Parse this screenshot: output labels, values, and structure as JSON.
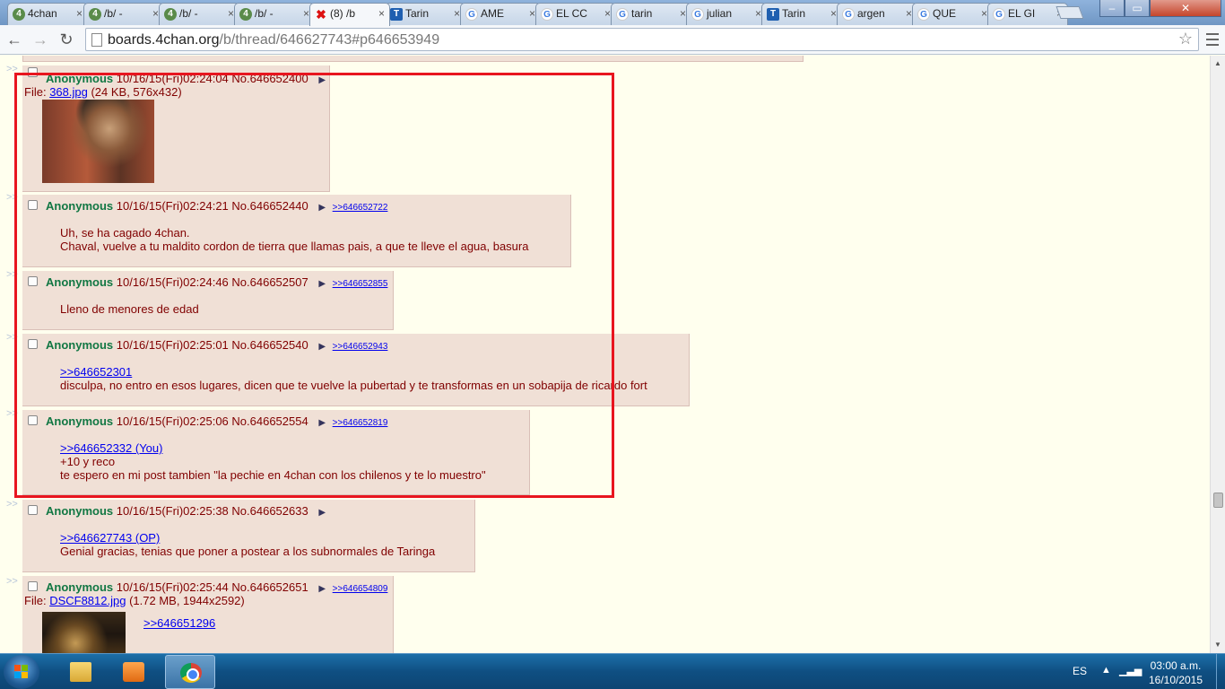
{
  "browser": {
    "tabs": [
      {
        "label": "4chan",
        "icon": "fourchan-icon"
      },
      {
        "label": "/b/ -",
        "icon": "fourchan-icon"
      },
      {
        "label": "/b/ -",
        "icon": "fourchan-icon"
      },
      {
        "label": "/b/ -",
        "icon": "fourchan-icon"
      },
      {
        "label": "(8) /b",
        "icon": "fourchan-clover-icon",
        "active": true
      },
      {
        "label": "Tarin",
        "icon": "taringa-icon"
      },
      {
        "label": "AME",
        "icon": "google-icon"
      },
      {
        "label": "EL CC",
        "icon": "google-icon"
      },
      {
        "label": "tarin",
        "icon": "google-icon"
      },
      {
        "label": "julian",
        "icon": "google-icon"
      },
      {
        "label": "Tarin",
        "icon": "taringa-icon"
      },
      {
        "label": "argen",
        "icon": "google-icon"
      },
      {
        "label": "QUE",
        "icon": "google-icon"
      },
      {
        "label": "EL GI",
        "icon": "google-icon"
      }
    ],
    "tab_close": "×",
    "url_host": "boards.4chan.org",
    "url_path": "/b/thread/646627743#p646653949",
    "back": "←",
    "forward": "→",
    "reload": "↻",
    "star": "☆",
    "win_min": "–",
    "win_max": "▭",
    "win_close": "✕"
  },
  "thread": {
    "side_arrows": ">>",
    "posts": [
      {
        "name": "Anonymous",
        "datetime": "10/16/15(Fri)02:24:04",
        "no": "No.646652400",
        "tri": "▶",
        "reply": "",
        "file_label": "File:",
        "file_name": "368.jpg",
        "file_meta": "(24 KB, 576x432)",
        "lines": []
      },
      {
        "name": "Anonymous",
        "datetime": "10/16/15(Fri)02:24:21",
        "no": "No.646652440",
        "tri": "▶",
        "reply": ">>646652722",
        "lines": [
          "Uh, se ha cagado 4chan.",
          "Chaval, vuelve a tu maldito cordon de tierra que llamas pais, a que te lleve el agua, basura"
        ]
      },
      {
        "name": "Anonymous",
        "datetime": "10/16/15(Fri)02:24:46",
        "no": "No.646652507",
        "tri": "▶",
        "reply": ">>646652855",
        "lines": [
          "Lleno de menores de edad"
        ]
      },
      {
        "name": "Anonymous",
        "datetime": "10/16/15(Fri)02:25:01",
        "no": "No.646652540",
        "tri": "▶",
        "reply": ">>646652943",
        "quote": ">>646652301",
        "lines": [
          "disculpa, no entro en esos lugares, dicen que te vuelve la pubertad y te transformas en un sobapija de ricardo fort"
        ]
      },
      {
        "name": "Anonymous",
        "datetime": "10/16/15(Fri)02:25:06",
        "no": "No.646652554",
        "tri": "▶",
        "reply": ">>646652819",
        "quote": ">>646652332 (You)",
        "lines": [
          "+10 y reco",
          "te espero en mi post tambien \"la pechie en 4chan con los chilenos y te lo muestro\""
        ]
      },
      {
        "name": "Anonymous",
        "datetime": "10/16/15(Fri)02:25:38",
        "no": "No.646652633",
        "tri": "▶",
        "reply": "",
        "quote": ">>646627743 (OP)",
        "lines": [
          "Genial gracias, tenias que poner a postear a los subnormales de Taringa"
        ]
      },
      {
        "name": "Anonymous",
        "datetime": "10/16/15(Fri)02:25:44",
        "no": "No.646652651",
        "tri": "▶",
        "reply": ">>646654809",
        "file_label": "File:",
        "file_name": "DSCF8812.jpg",
        "file_meta": "(1.72 MB, 1944x2592)",
        "quote": ">>646651296",
        "lines": []
      }
    ]
  },
  "taskbar": {
    "language": "ES",
    "time": "03:00 a.m.",
    "date": "16/10/2015"
  },
  "colors": {
    "page_bg": "#ffffee",
    "post_bg": "#f0e0d6",
    "name": "#117743",
    "text": "#800000",
    "link": "#0000ee",
    "highlight_box": "#e8151f"
  }
}
